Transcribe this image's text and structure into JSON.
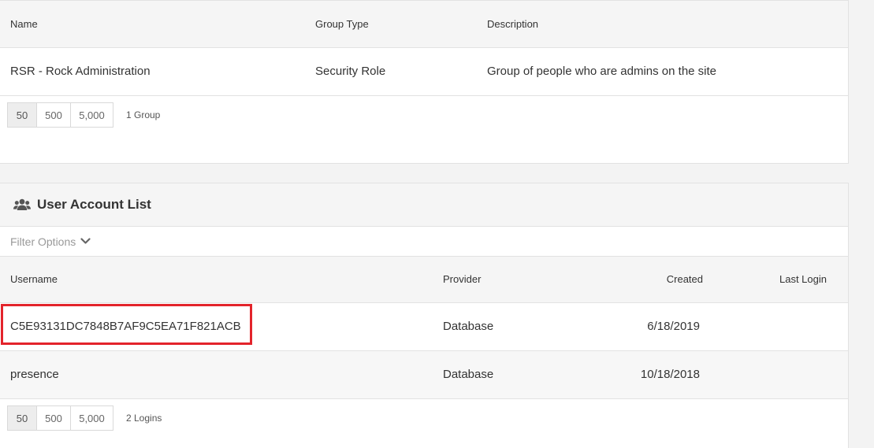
{
  "groups": {
    "columns": {
      "name": "Name",
      "group_type": "Group Type",
      "description": "Description"
    },
    "rows": [
      {
        "name": "RSR - Rock Administration",
        "group_type": "Security Role",
        "description": "Group of people who are admins on the site"
      }
    ],
    "pager": {
      "sizes": [
        "50",
        "500",
        "5,000"
      ],
      "count": "1 Group"
    }
  },
  "users": {
    "title": "User Account List",
    "title_icon": "users-icon",
    "filter_label": "Filter Options",
    "columns": {
      "username": "Username",
      "provider": "Provider",
      "created": "Created",
      "last_login": "Last Login"
    },
    "rows": [
      {
        "username": "C5E93131DC7848B7AF9C5EA71F821ACB",
        "provider": "Database",
        "created": "6/18/2019",
        "last_login": ""
      },
      {
        "username": "presence",
        "provider": "Database",
        "created": "10/18/2018",
        "last_login": ""
      }
    ],
    "pager": {
      "sizes": [
        "50",
        "500",
        "5,000"
      ],
      "count": "2 Logins"
    }
  },
  "colors": {
    "highlight": "#e3242b",
    "header_bg": "#f5f5f5",
    "border": "#e2e2e2"
  }
}
